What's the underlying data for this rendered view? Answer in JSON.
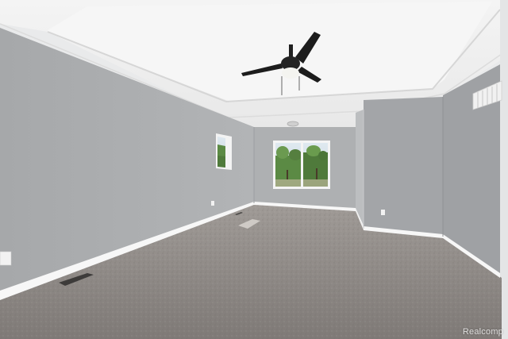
{
  "photo": {
    "watermark": "Realcomp",
    "colors": {
      "ceiling": "#f2f2f2",
      "wall": "#a9abad",
      "wall_dark": "#999b9e",
      "carpet": "#8c8784",
      "trim": "#f7f7f7",
      "fan": "#1f1f1f",
      "foliage": "#4f7a3b"
    },
    "objects": [
      "ceiling-fan",
      "window-back",
      "window-side",
      "floor-vent",
      "wall-outlet",
      "ceiling-light",
      "hvac-return-vent"
    ]
  }
}
